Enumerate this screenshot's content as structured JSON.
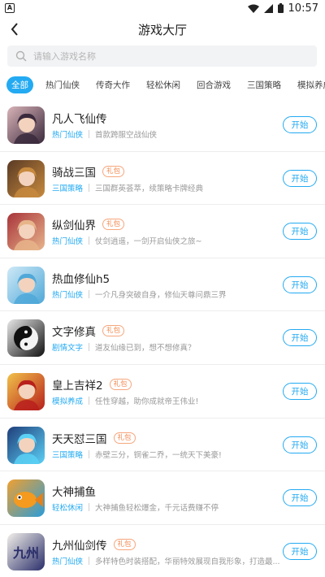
{
  "status_bar": {
    "app_badge": "A",
    "time": "10:57"
  },
  "header": {
    "title": "游戏大厅"
  },
  "search": {
    "placeholder": "请输入游戏名称"
  },
  "tabs": [
    "全部",
    "热门仙侠",
    "传奇大作",
    "轻松休闲",
    "回合游戏",
    "三国策略",
    "模拟养成"
  ],
  "games": [
    {
      "name": "凡人飞仙传",
      "gift": "",
      "category": "热门仙侠",
      "desc": "首款跨服空战仙侠",
      "button": "开始",
      "icon": "xian-girl-icon",
      "colors": [
        "#d9b3b8",
        "#3a2a3c"
      ]
    },
    {
      "name": "骑战三国",
      "gift": "礼包",
      "category": "三国策略",
      "desc": "三国群英荟萃，续策略卡牌经典",
      "button": "开始",
      "icon": "warrior-icon",
      "colors": [
        "#5a3a24",
        "#c78a3e"
      ]
    },
    {
      "name": "纵剑仙界",
      "gift": "礼包",
      "category": "热门仙侠",
      "desc": "仗剑逍遥，一剑开启仙侠之旅~",
      "button": "开始",
      "icon": "sword-fairy-icon",
      "colors": [
        "#a8343a",
        "#e7b48a"
      ]
    },
    {
      "name": "热血修仙h5",
      "gift": "",
      "category": "热门仙侠",
      "desc": "一介凡身突破自身，修仙天尊问鼎三界",
      "button": "开始",
      "icon": "xian-calligraphy-icon",
      "colors": [
        "#cfe9f7",
        "#4fa8d8"
      ]
    },
    {
      "name": "文字修真",
      "gift": "礼包",
      "category": "剧情文字",
      "desc": "道友仙缘已到，想不想修真？",
      "button": "开始",
      "icon": "yinyang-icon",
      "colors": [
        "#e8e8e8",
        "#111111"
      ]
    },
    {
      "name": "皇上吉祥2",
      "gift": "礼包",
      "category": "模拟养成",
      "desc": "任性穿越，助你成就帝王伟业!",
      "button": "开始",
      "icon": "emperor-icon",
      "colors": [
        "#f1c24a",
        "#b8201c"
      ]
    },
    {
      "name": "天天怼三国",
      "gift": "礼包",
      "category": "三国策略",
      "desc": "赤壁三分，铜雀二乔，一统天下美豪!",
      "button": "开始",
      "icon": "anime-hero-icon",
      "colors": [
        "#1f3e7a",
        "#5bd0f5"
      ]
    },
    {
      "name": "大神捕鱼",
      "gift": "",
      "category": "轻松休闲",
      "desc": "大神捕鱼轻松爆金，千元话费赚不停",
      "button": "开始",
      "icon": "goldfish-icon",
      "colors": [
        "#f0a030",
        "#2a9cd8"
      ]
    },
    {
      "name": "九州仙剑传",
      "gift": "礼包",
      "category": "热门仙侠",
      "desc": "多样特色时装搭配，华丽特效展现自我形象，打造最...",
      "button": "开始",
      "icon": "jiuzhou-logo-icon",
      "colors": [
        "#f3f0ea",
        "#2a2e6a"
      ],
      "logo_text": "九州"
    }
  ]
}
